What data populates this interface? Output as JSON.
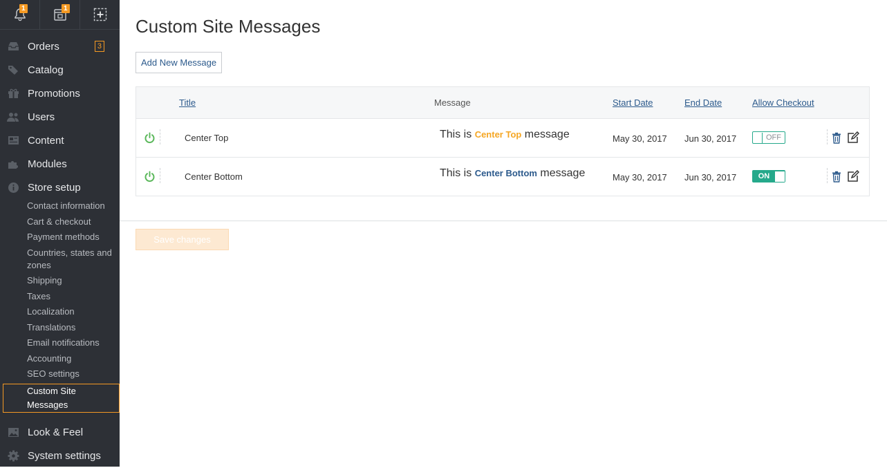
{
  "topbar": {
    "notifications_badge": "1",
    "storefront_badge": "1"
  },
  "sidebar": {
    "nav": [
      {
        "label": "Orders",
        "count": "3",
        "icon": "inbox-icon"
      },
      {
        "label": "Catalog",
        "icon": "tags-icon"
      },
      {
        "label": "Promotions",
        "icon": "gift-icon"
      },
      {
        "label": "Users",
        "icon": "users-icon"
      },
      {
        "label": "Content",
        "icon": "content-icon"
      },
      {
        "label": "Modules",
        "icon": "puzzle-icon"
      },
      {
        "label": "Store setup",
        "icon": "info-icon"
      }
    ],
    "store_setup_items": [
      "Contact information",
      "Cart & checkout",
      "Payment methods",
      "Countries, states and zones",
      "Shipping",
      "Taxes",
      "Localization",
      "Translations",
      "Email notifications",
      "Accounting",
      "SEO settings",
      "Custom Site Messages"
    ],
    "bottom_nav": [
      {
        "label": "Look & Feel",
        "icon": "image-icon"
      },
      {
        "label": "System settings",
        "icon": "gear-icon"
      }
    ]
  },
  "main": {
    "title": "Custom Site Messages",
    "add_button": "Add New Message",
    "columns": {
      "title": "Title",
      "message": "Message",
      "start_date": "Start Date",
      "end_date": "End Date",
      "allow_checkout": "Allow Checkout"
    },
    "rows": [
      {
        "title": "Center Top",
        "msg_prefix": "This is",
        "msg_highlight": "Center Top",
        "msg_suffix": "message",
        "start": "May 30, 2017",
        "end": "Jun 30, 2017",
        "checkout": "OFF"
      },
      {
        "title": "Center Bottom",
        "msg_prefix": "This is",
        "msg_highlight": "Center Bottom",
        "msg_suffix": "message",
        "start": "May 30, 2017",
        "end": "Jun 30, 2017",
        "checkout": "ON"
      }
    ],
    "save_button": "Save changes"
  },
  "colors": {
    "accent": "#f59a23",
    "toggle_green": "#25a98b",
    "link_blue": "#2c5a8c",
    "sidebar_bg": "#2d3036"
  }
}
